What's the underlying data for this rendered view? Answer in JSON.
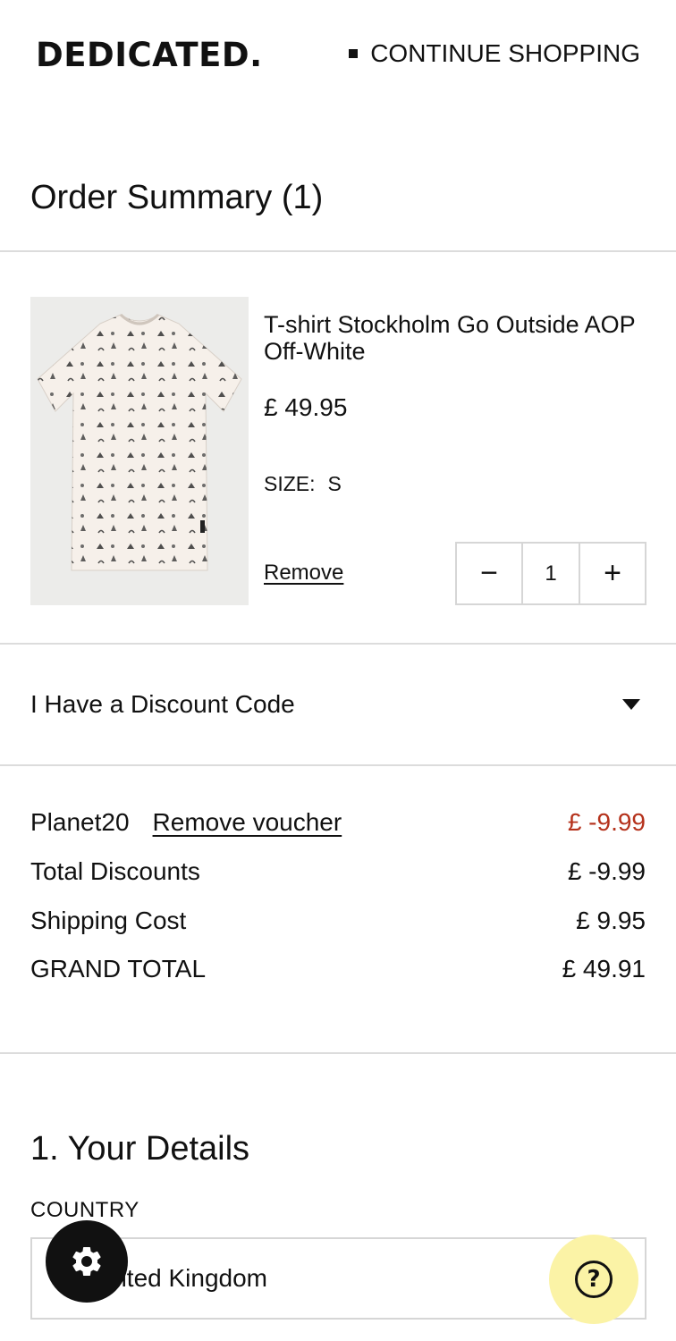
{
  "header": {
    "logo": "DEDICATED.",
    "continue_label": "CONTINUE SHOPPING"
  },
  "summary": {
    "title": "Order Summary (1)"
  },
  "product": {
    "name": "T-shirt Stockholm Go Outside AOP Off-White",
    "price": "£ 49.95",
    "size_label": "SIZE:",
    "size_value": "S",
    "remove_label": "Remove",
    "quantity": "1",
    "minus_glyph": "−",
    "plus_glyph": "+",
    "image_icon": "tshirt-icon"
  },
  "discount": {
    "label": "I Have a Discount Code",
    "icon": "caret-down-icon"
  },
  "totals": {
    "voucher_code": "Planet20",
    "remove_voucher_label": "Remove voucher",
    "voucher_amount": "£ -9.99",
    "total_discounts_label": "Total Discounts",
    "total_discounts_value": "£ -9.99",
    "shipping_label": "Shipping Cost",
    "shipping_value": "£ 9.95",
    "grand_total_label": "GRAND TOTAL",
    "grand_total_value": "£ 49.91"
  },
  "details": {
    "title": "1. Your Details",
    "country_label": "COUNTRY",
    "country_value": "nited Kingdom"
  },
  "fabs": {
    "settings_icon": "gear-icon",
    "help_icon": "question-icon",
    "help_glyph": "?"
  },
  "colors": {
    "accent_red": "#b5321c",
    "help_bg": "#fbf3a6",
    "divider": "#dcdcdc"
  }
}
